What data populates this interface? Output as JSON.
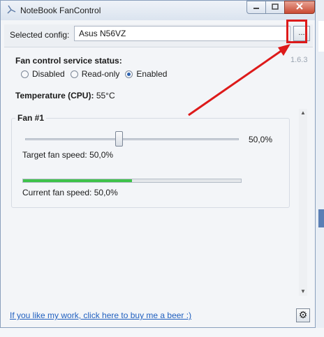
{
  "window": {
    "title": "NoteBook FanControl",
    "app_icon": "fan-icon",
    "controls": {
      "minimize": "minimize-icon",
      "maximize": "maximize-icon",
      "close": "close-icon"
    }
  },
  "config": {
    "label": "Selected config:",
    "value": "Asus N56VZ",
    "browse_label": "..."
  },
  "version": "1.6.3",
  "service": {
    "heading": "Fan control service status:",
    "options": [
      {
        "label": "Disabled",
        "selected": false
      },
      {
        "label": "Read-only",
        "selected": false
      },
      {
        "label": "Enabled",
        "selected": true
      }
    ]
  },
  "temperature": {
    "label": "Temperature (CPU):",
    "value": "55°C"
  },
  "fan": {
    "title": "Fan #1",
    "slider_value": "50,0%",
    "slider_level": 0.5,
    "target_label": "Target fan speed:",
    "target_value": "50,0%",
    "current_label": "Current fan speed:",
    "current_value": "50,0%",
    "current_progress": 0.5
  },
  "footer": {
    "link": "If you like my work, click here to buy me a beer :)",
    "settings_icon": "gear-icon"
  },
  "background": {
    "bottom_text": ""
  },
  "colors": {
    "annotation": "#dd1a1a",
    "progress": "#3fc24a",
    "link": "#1f5fbf"
  }
}
